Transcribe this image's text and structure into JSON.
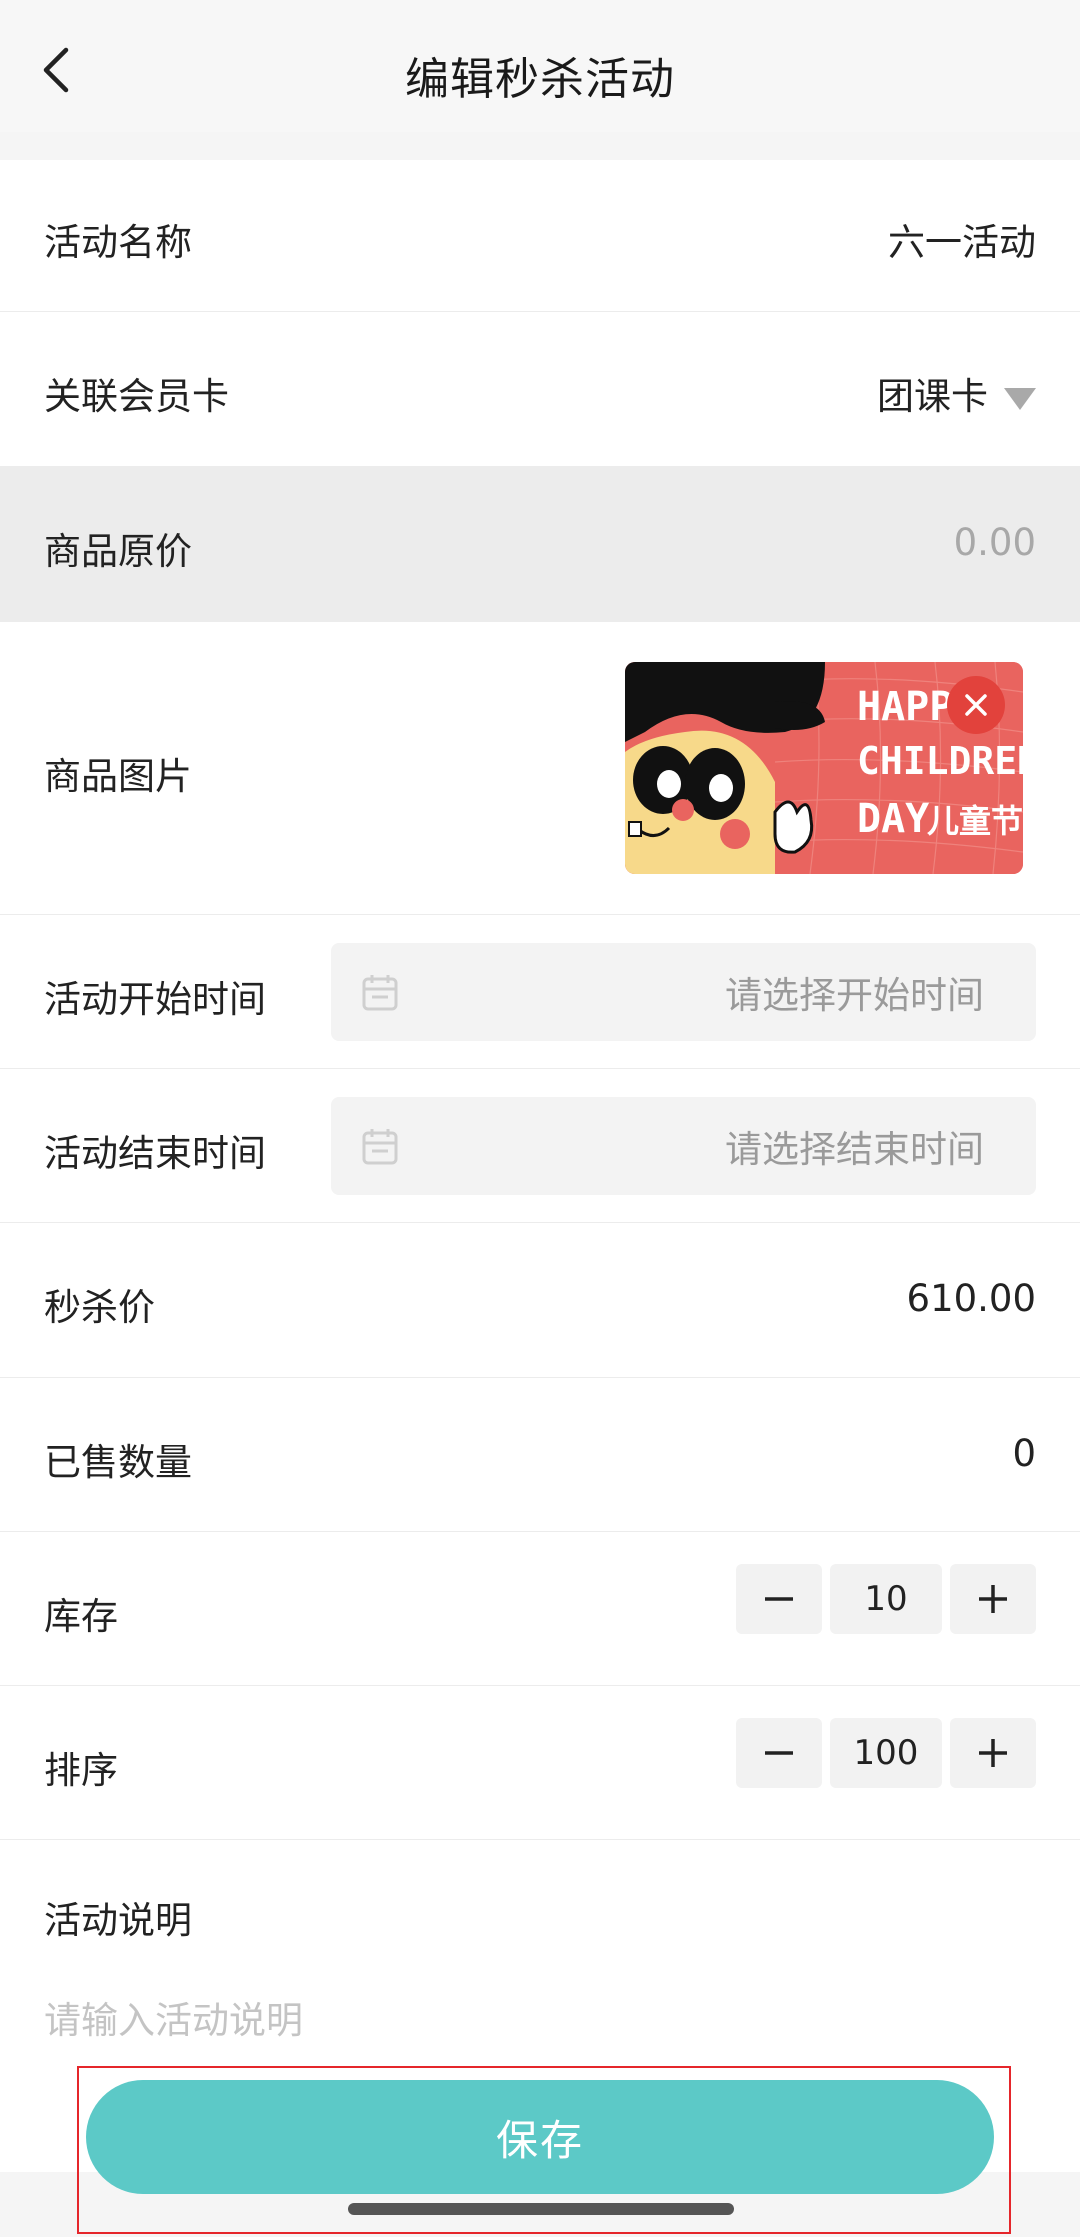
{
  "header": {
    "title": "编辑秒杀活动"
  },
  "form": {
    "activity_name": {
      "label": "活动名称",
      "value": "六一活动"
    },
    "member_card": {
      "label": "关联会员卡",
      "value": "团课卡"
    },
    "original_price": {
      "label": "商品原价",
      "value": "0.00"
    },
    "product_image": {
      "label": "商品图片",
      "image_text": [
        "HAPPY",
        "CHILDREN'S",
        "DAY",
        "儿童节"
      ]
    },
    "start_time": {
      "label": "活动开始时间",
      "placeholder": "请选择开始时间"
    },
    "end_time": {
      "label": "活动结束时间",
      "placeholder": "请选择结束时间"
    },
    "flash_price": {
      "label": "秒杀价",
      "value": "610.00"
    },
    "sold_count": {
      "label": "已售数量",
      "value": "0"
    },
    "stock": {
      "label": "库存",
      "value": "10"
    },
    "sort": {
      "label": "排序",
      "value": "100"
    },
    "description": {
      "label": "活动说明",
      "placeholder": "请输入活动说明"
    }
  },
  "actions": {
    "save_label": "保存"
  },
  "colors": {
    "accent": "#5cc9c7",
    "highlight_outline": "#e5262b",
    "image_bg": "#e9645f"
  }
}
